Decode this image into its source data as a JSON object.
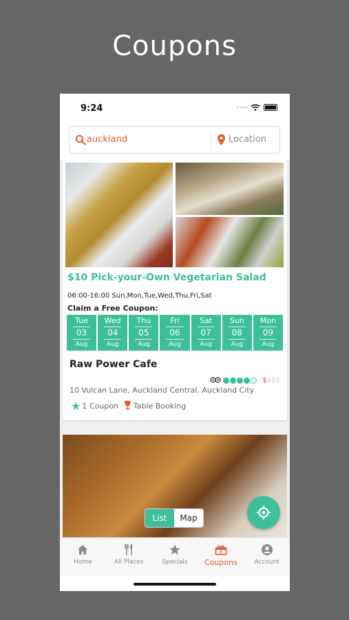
{
  "heading": "Coupons",
  "status": {
    "time": "9:24"
  },
  "search": {
    "query": "auckland",
    "location_placeholder": "Location"
  },
  "deal": {
    "title": "$10 Pick-your-Own Vegetarian Salad",
    "hours": "06:00-16:00 Sun,Mon,Tue,Wed,Thu,Fri,Sat",
    "claim_label": "Claim a Free Coupon:",
    "days": [
      {
        "name": "Tue",
        "date": "03",
        "month": "Aug"
      },
      {
        "name": "Wed",
        "date": "04",
        "month": "Aug"
      },
      {
        "name": "Thu",
        "date": "05",
        "month": "Aug"
      },
      {
        "name": "Fri",
        "date": "06",
        "month": "Aug"
      },
      {
        "name": "Sat",
        "date": "07",
        "month": "Aug"
      },
      {
        "name": "Sun",
        "date": "08",
        "month": "Aug"
      },
      {
        "name": "Mon",
        "date": "09",
        "month": "Aug"
      }
    ],
    "venue": "Raw Power Cafe",
    "rating_bubbles": 4,
    "rating_max": 5,
    "price_on": "$",
    "price_off": "$$$",
    "address": "10 Vulcan Lane, Auckland Central, Auckland City",
    "coupons": "1 Coupon",
    "booking": "Table Booking"
  },
  "view_toggle": {
    "list": "List",
    "map": "Map",
    "selected": "List"
  },
  "tabs": [
    {
      "label": "Home",
      "icon": "home-icon",
      "active": false
    },
    {
      "label": "All Places",
      "icon": "cutlery-icon",
      "active": false
    },
    {
      "label": "Specials",
      "icon": "star-icon",
      "active": false
    },
    {
      "label": "Coupons",
      "icon": "ticket-icon",
      "active": true
    },
    {
      "label": "Account",
      "icon": "account-icon",
      "active": false
    }
  ],
  "colors": {
    "accent": "#3dbf9a",
    "brand": "#e8572f",
    "backdrop": "#666666"
  }
}
